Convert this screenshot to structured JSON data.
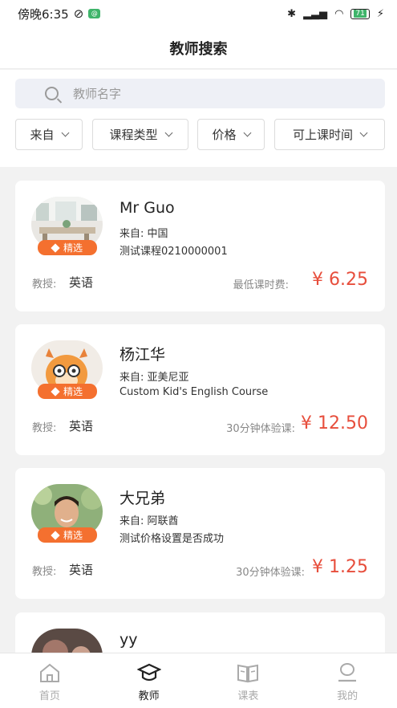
{
  "status_bar": {
    "time": "傍晚6:35",
    "notification_badge": "@",
    "battery_level": "71"
  },
  "page_title": "教师搜索",
  "search": {
    "placeholder": "教师名字"
  },
  "filters": [
    {
      "label": "来自"
    },
    {
      "label": "课程类型"
    },
    {
      "label": "价格"
    },
    {
      "label": "可上课时间"
    }
  ],
  "badge_label": "精选",
  "teach_label": "教授:",
  "teachers": [
    {
      "name": "Mr Guo",
      "from": "来自:  中国",
      "course": "测试课程0210000001",
      "subject": "英语",
      "price_label": "最低课时费:",
      "price": "¥ 6.25",
      "featured": true
    },
    {
      "name": "杨江华",
      "from": "来自:  亚美尼亚",
      "course": "Custom Kid's English Course",
      "subject": "英语",
      "price_label": "30分钟体验课:",
      "price": "¥ 12.50",
      "featured": true
    },
    {
      "name": "大兄弟",
      "from": "来自:  阿联酋",
      "course": "测试价格设置是否成功",
      "subject": "英语",
      "price_label": "30分钟体验课:",
      "price": "¥ 1.25",
      "featured": true
    },
    {
      "name": "yy"
    }
  ],
  "tabs": [
    {
      "label": "首页",
      "icon": "home-icon",
      "active": false
    },
    {
      "label": "教师",
      "icon": "graduation-cap-icon",
      "active": true
    },
    {
      "label": "课表",
      "icon": "book-icon",
      "active": false
    },
    {
      "label": "我的",
      "icon": "user-icon",
      "active": false
    }
  ],
  "colors": {
    "accent_price": "#e74e3c",
    "badge": "#f4702f",
    "search_bg": "#eef0f6"
  }
}
